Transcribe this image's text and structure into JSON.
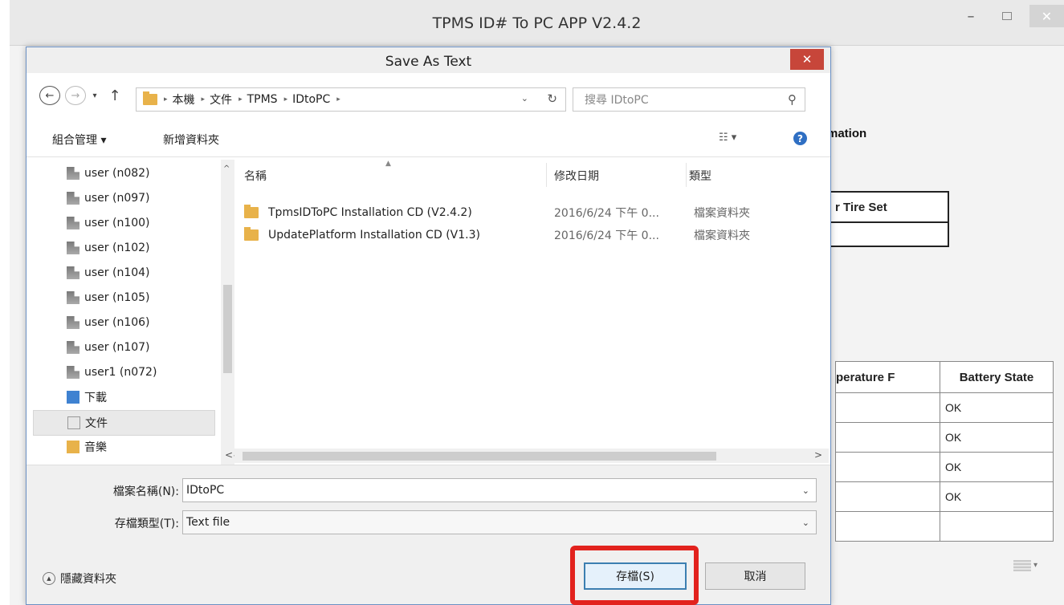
{
  "app": {
    "title": "TPMS ID# To PC APP V2.4.2",
    "minimize_glyph": "–",
    "close_glyph": "✕",
    "background": {
      "heading_fragment": "mation",
      "tire_table_header_fragment": "r Tire Set",
      "data_table": {
        "headers": [
          "perature F",
          "Battery State"
        ],
        "rows": [
          [
            "",
            "OK"
          ],
          [
            "",
            "OK"
          ],
          [
            "",
            "OK"
          ],
          [
            "",
            "OK"
          ],
          [
            "",
            ""
          ]
        ]
      }
    }
  },
  "dialog": {
    "title": "Save As Text",
    "close_glyph": "✕",
    "nav": {
      "back_glyph": "←",
      "forward_glyph": "→",
      "recent_glyph": "▾",
      "up_glyph": "↑"
    },
    "address": {
      "crumbs": [
        "本機",
        "文件",
        "TPMS",
        "IDtoPC"
      ],
      "separator": "▸",
      "chevron": "⌄",
      "refresh_glyph": "↻"
    },
    "search": {
      "placeholder": "搜尋 IDtoPC",
      "icon_glyph": "⚲"
    },
    "toolbar": {
      "organize": "組合管理 ▾",
      "new_folder": "新增資料夾",
      "view_glyph": "☷ ▾",
      "help_glyph": "?"
    },
    "nav_pane": {
      "items": [
        "user (n082)",
        "user (n097)",
        "user (n100)",
        "user (n102)",
        "user (n104)",
        "user (n105)",
        "user (n106)",
        "user (n107)",
        "user1 (n072)",
        "下載",
        "文件",
        "音樂"
      ],
      "selected": "文件",
      "scroll_up": "^",
      "scroll_down": "⌄"
    },
    "file_list": {
      "columns": [
        "名稱",
        "修改日期",
        "類型"
      ],
      "sort_glyph": "▲",
      "rows": [
        {
          "name": "TpmsIDToPC Installation CD (V2.4.2)",
          "date": "2016/6/24 下午 0...",
          "type": "檔案資料夾"
        },
        {
          "name": "UpdatePlatform Installation CD (V1.3)",
          "date": "2016/6/24 下午 0...",
          "type": "檔案資料夾"
        }
      ],
      "scroll_left": "<",
      "scroll_right": ">"
    },
    "fields": {
      "filename_label": "檔案名稱(N):",
      "filename_value": "IDtoPC",
      "filetype_label": "存檔類型(T):",
      "filetype_value": "Text file",
      "chevron": "⌄"
    },
    "footer": {
      "hide_folders": "隱藏資料夾",
      "hide_glyph": "▲",
      "save": "存檔(S)",
      "cancel": "取消"
    },
    "highlight_color": "#e2221d",
    "close_color": "#c7463a"
  }
}
